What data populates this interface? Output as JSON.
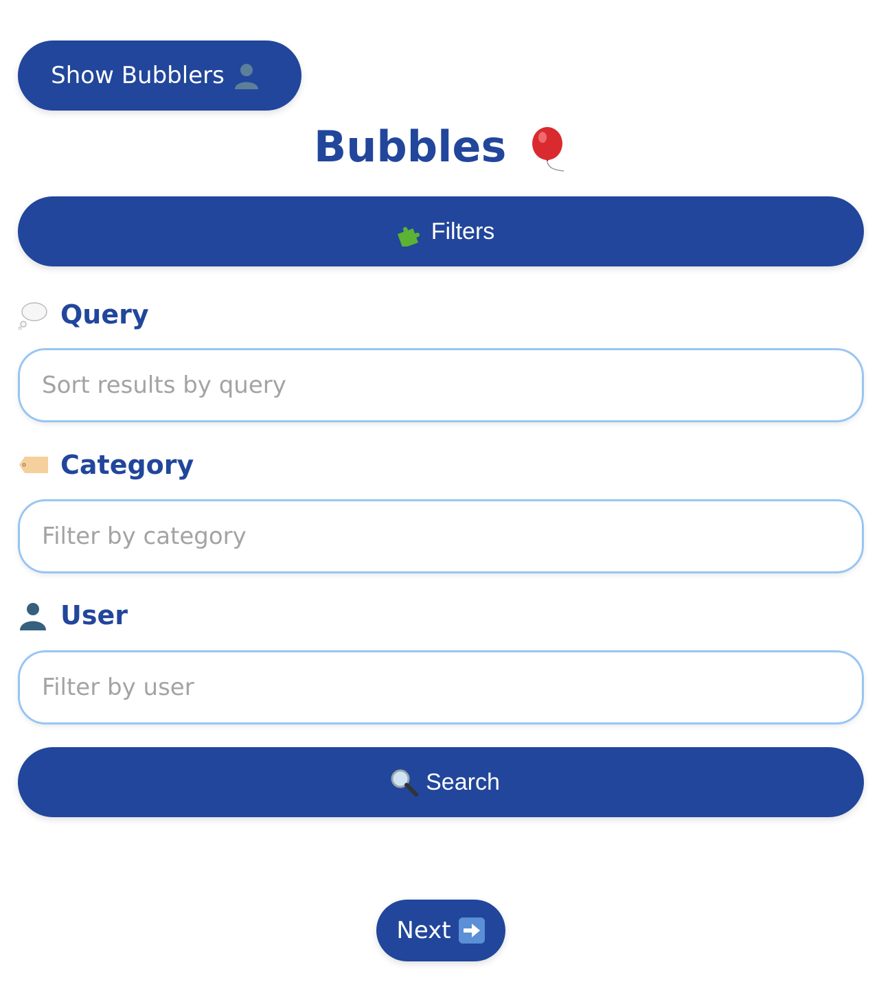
{
  "header": {
    "show_bubblers_label": "Show Bubblers",
    "title": "Bubbles"
  },
  "filters": {
    "toggle_label": "Filters",
    "query": {
      "label": "Query",
      "placeholder": "Sort results by query",
      "value": ""
    },
    "category": {
      "label": "Category",
      "placeholder": "Filter by category",
      "value": ""
    },
    "user": {
      "label": "User",
      "placeholder": "Filter by user",
      "value": ""
    },
    "search_label": "Search"
  },
  "pagination": {
    "next_label": "Next"
  },
  "icons": {
    "show_bubblers": "user-silhouette-icon",
    "title": "balloon-icon",
    "filters": "puzzle-piece-icon",
    "query": "thought-bubble-icon",
    "category": "tag-icon",
    "user": "user-silhouette-icon",
    "search": "magnifying-glass-icon",
    "next": "right-arrow-icon"
  },
  "colors": {
    "primary": "#21469b",
    "input_border": "#98c5f3",
    "placeholder": "#a3a3a3",
    "background": "#ffffff"
  }
}
